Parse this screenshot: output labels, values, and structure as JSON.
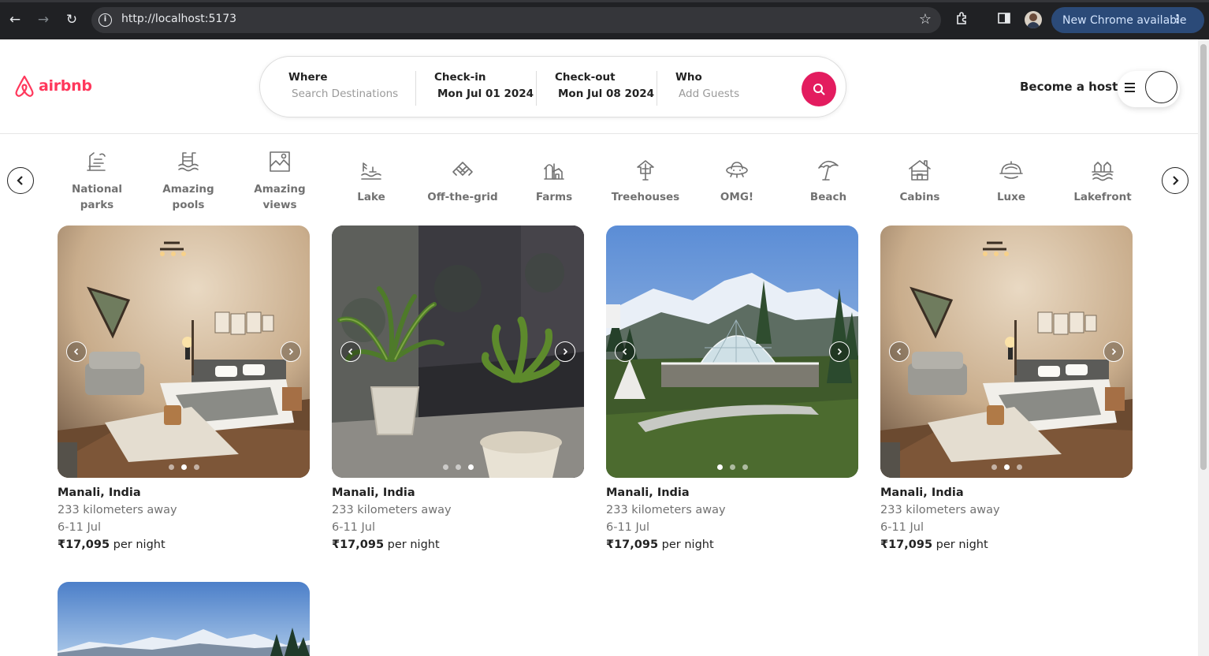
{
  "browser": {
    "url": "http://localhost:5173",
    "update_label": "New Chrome available"
  },
  "header": {
    "logo_text": "airbnb",
    "search": {
      "where_label": "Where",
      "where_placeholder": "Search Destinations",
      "checkin_label": "Check-in",
      "checkin_value": "Mon Jul 01 2024",
      "checkout_label": "Check-out",
      "checkout_value": "Mon Jul 08 2024",
      "who_label": "Who",
      "who_placeholder": "Add Guests"
    },
    "become_host": "Become a host"
  },
  "categories": [
    {
      "line1": "National",
      "line2": "parks",
      "icon": "national-parks-icon"
    },
    {
      "line1": "Amazing",
      "line2": "pools",
      "icon": "pool-icon"
    },
    {
      "line1": "Amazing",
      "line2": "views",
      "icon": "views-icon"
    },
    {
      "line1": "Lake",
      "line2": "",
      "icon": "lake-icon"
    },
    {
      "line1": "Off-the-grid",
      "line2": "",
      "icon": "off-grid-icon"
    },
    {
      "line1": "Farms",
      "line2": "",
      "icon": "farm-icon"
    },
    {
      "line1": "Treehouses",
      "line2": "",
      "icon": "treehouse-icon"
    },
    {
      "line1": "OMG!",
      "line2": "",
      "icon": "ufo-icon"
    },
    {
      "line1": "Beach",
      "line2": "",
      "icon": "beach-icon"
    },
    {
      "line1": "Cabins",
      "line2": "",
      "icon": "cabin-icon"
    },
    {
      "line1": "Luxe",
      "line2": "",
      "icon": "luxe-icon"
    },
    {
      "line1": "Lakefront",
      "line2": "",
      "icon": "lakefront-icon"
    }
  ],
  "listings": [
    {
      "title": "Manali, India",
      "distance": "233 kilometers away",
      "dates": "6-11 Jul",
      "price": "₹17,095",
      "per": "per night",
      "active_dot": 1
    },
    {
      "title": "Manali, India",
      "distance": "233 kilometers away",
      "dates": "6-11 Jul",
      "price": "₹17,095",
      "per": "per night",
      "active_dot": 2
    },
    {
      "title": "Manali, India",
      "distance": "233 kilometers away",
      "dates": "6-11 Jul",
      "price": "₹17,095",
      "per": "per night",
      "active_dot": 0
    },
    {
      "title": "Manali, India",
      "distance": "233 kilometers away",
      "dates": "6-11 Jul",
      "price": "₹17,095",
      "per": "per night",
      "active_dot": 1
    }
  ],
  "colors": {
    "brand": "#ff385c",
    "search_button": "#e31c5f",
    "muted_text": "#717171"
  }
}
